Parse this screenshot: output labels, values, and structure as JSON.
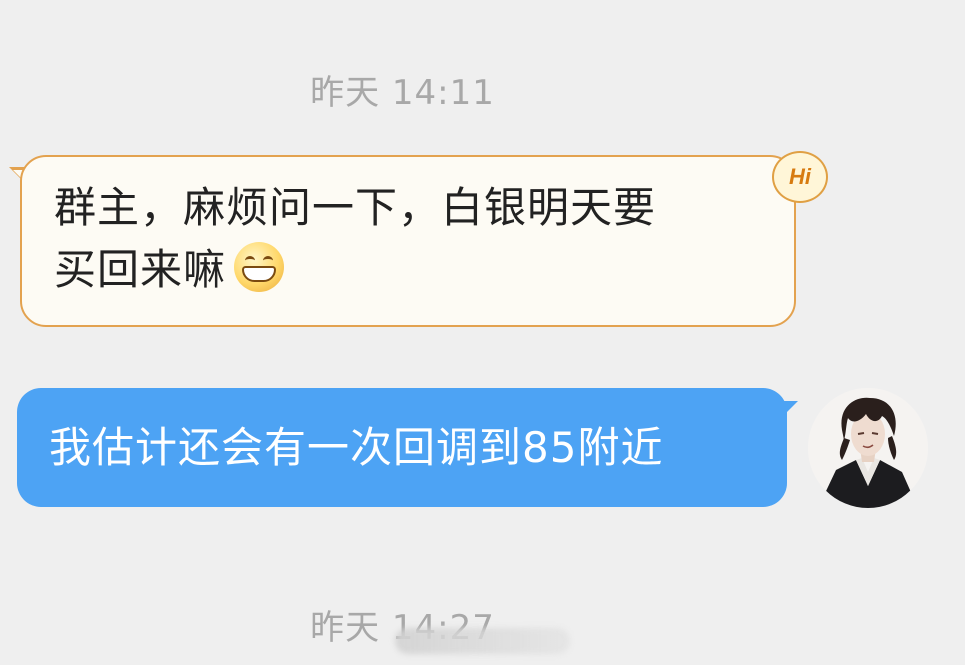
{
  "timestamps": [
    {
      "text": "昨天 14:11"
    },
    {
      "text": "昨天 14:27"
    }
  ],
  "messages": [
    {
      "direction": "incoming",
      "line1": "群主，麻烦问一下，白银明天要",
      "line2": "买回来嘛",
      "emoji": "grin-emoji",
      "badge": "Hi"
    },
    {
      "direction": "outgoing",
      "text": "我估计还会有一次回调到85附近",
      "avatar": "user-avatar"
    }
  ],
  "colors": {
    "background": "#efefef",
    "incoming_bubble": "#fdfbf4",
    "incoming_border": "#e3a24f",
    "outgoing_bubble": "#4da3f4",
    "timestamp_text": "#a8a8a8"
  }
}
